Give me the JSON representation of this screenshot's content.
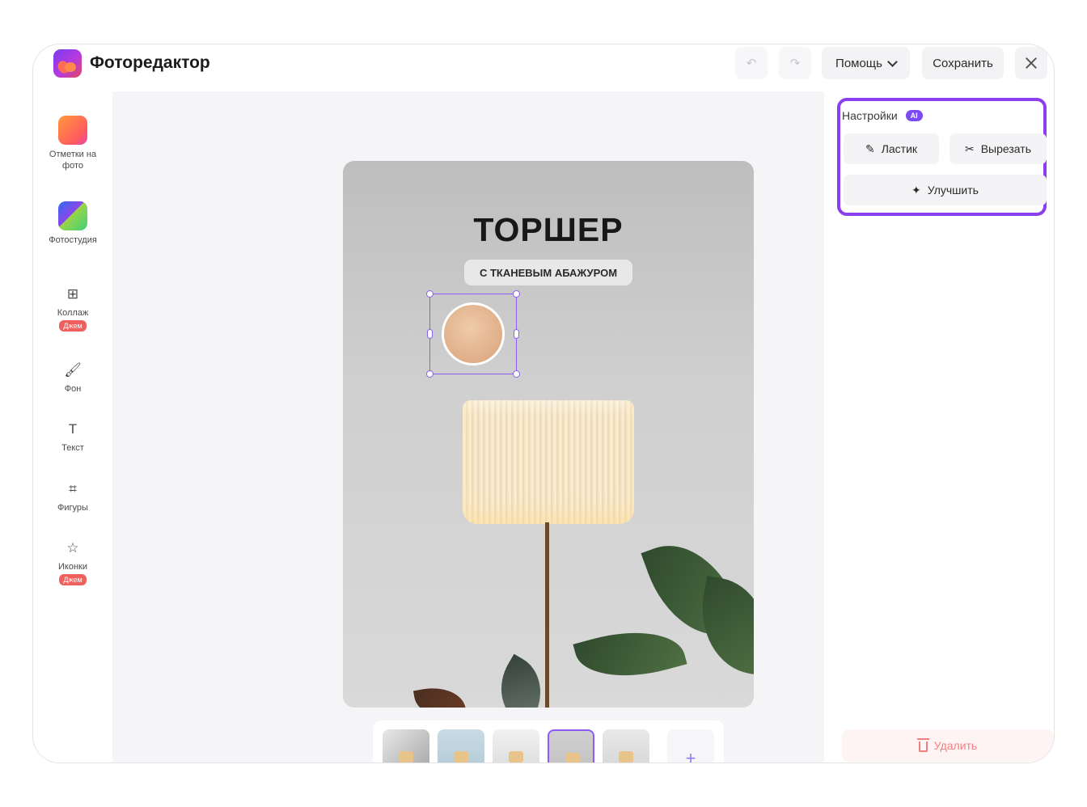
{
  "header": {
    "app_title": "Фоторедактор",
    "undo_icon": "↶",
    "redo_icon": "↷",
    "help_label": "Помощь",
    "save_label": "Сохранить"
  },
  "sidebar": {
    "items": [
      {
        "label": "Отметки на фото",
        "icon": "photo-marks-icon"
      },
      {
        "label": "Фотостудия",
        "icon": "photo-studio-icon"
      },
      {
        "label": "Коллаж",
        "icon": "collage-icon",
        "glyph": "⊞",
        "badge": "Джем"
      },
      {
        "label": "Фон",
        "icon": "background-icon",
        "glyph": "🖌"
      },
      {
        "label": "Текст",
        "icon": "text-icon",
        "glyph": "T"
      },
      {
        "label": "Фигуры",
        "icon": "shapes-icon",
        "glyph": "⌗"
      },
      {
        "label": "Иконки",
        "icon": "star-icon",
        "glyph": "☆",
        "badge": "Джем"
      }
    ]
  },
  "canvas": {
    "title": "ТОРШЕР",
    "subtitle": "С ТКАНЕВЫМ АБАЖУРОМ",
    "add_page_label": "+"
  },
  "settings": {
    "title": "Настройки",
    "ai_badge": "AI",
    "eraser_label": "Ластик",
    "cut_label": "Вырезать",
    "enhance_label": "Улучшить",
    "delete_label": "Удалить"
  },
  "colors": {
    "accent": "#8b3ff0",
    "danger": "#f07f82",
    "badge": "#f0605c"
  }
}
